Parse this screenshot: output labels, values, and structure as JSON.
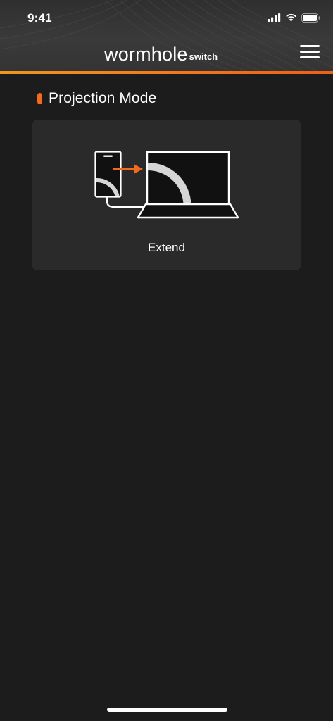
{
  "status_bar": {
    "time": "9:41"
  },
  "header": {
    "logo_main": "wormhole",
    "logo_sub": "switch",
    "menu_icon": "hamburger-menu-icon"
  },
  "section": {
    "title": "Projection Mode"
  },
  "mode_card": {
    "label": "Extend",
    "illustration_icon": "phone-extend-to-laptop-icon"
  },
  "colors": {
    "accent": "#f26a1b",
    "background": "#1c1c1c",
    "card": "#2a2a2a",
    "header": "#363636"
  }
}
